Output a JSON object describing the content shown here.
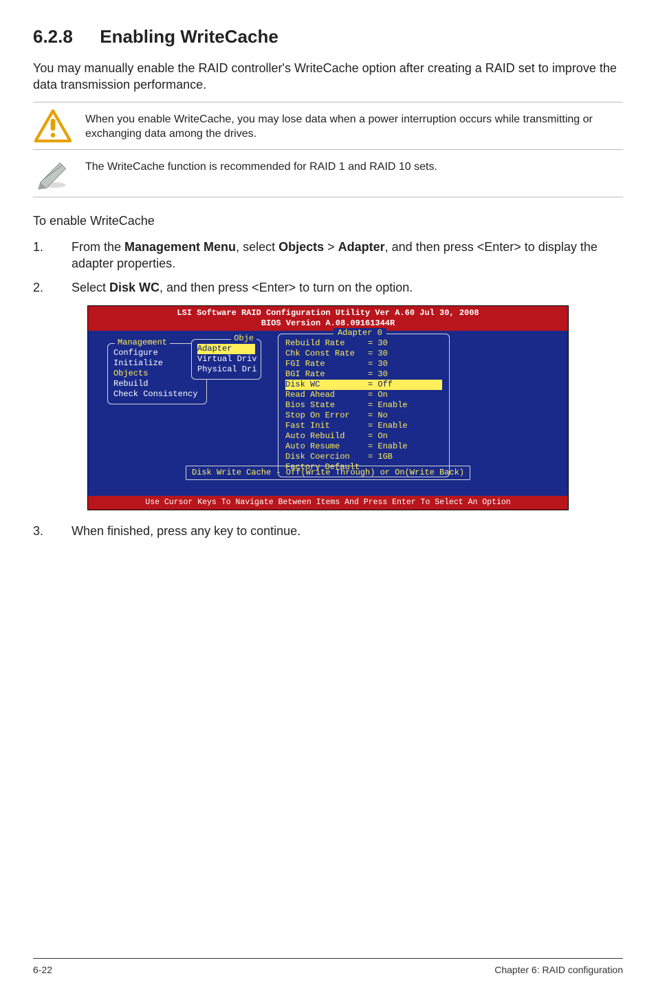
{
  "heading": {
    "number": "6.2.8",
    "title": "Enabling WriteCache"
  },
  "intro": "You may manually enable the RAID controller's WriteCache option after creating a RAID set to improve the data transmission performance.",
  "callouts": {
    "warning": "When you enable WriteCache, you may lose data when a power interruption occurs while transmitting or exchanging data among the drives.",
    "note": "The WriteCache function is recommended for RAID 1 and RAID 10 sets."
  },
  "subhead": "To enable WriteCache",
  "steps": [
    {
      "n": "1.",
      "pre": "From the ",
      "b1": "Management Menu",
      "mid1": ", select ",
      "b2": "Objects",
      "sep": " > ",
      "b3": "Adapter",
      "mid2": ", and then press <Enter> to display the adapter properties."
    },
    {
      "n": "2.",
      "pre": "Select ",
      "b1": "Disk WC",
      "mid1": ", and then press <Enter> to turn on the option."
    }
  ],
  "bios": {
    "title_line1": "LSI Software RAID Configuration Utility Ver A.60 Jul 30, 2008",
    "title_line2": "BIOS Version  A.08.09161344R",
    "mgmt_label": "Management",
    "mgmt_items": [
      "Configure",
      "Initialize",
      "Objects",
      "Rebuild",
      "Check Consistency"
    ],
    "obj_label": "Obje",
    "obj_items": [
      "Adapter",
      "Virtual Driv",
      "Physical Dri"
    ],
    "adapter_title": "Adapter 0",
    "adapter_props": [
      {
        "k": "Rebuild Rate",
        "v": "= 30"
      },
      {
        "k": "Chk Const Rate",
        "v": "= 30"
      },
      {
        "k": "FGI Rate",
        "v": "= 30"
      },
      {
        "k": "BGI Rate",
        "v": "= 30"
      },
      {
        "k": "Disk WC",
        "v": "= Off",
        "sel": true
      },
      {
        "k": "Read Ahead",
        "v": "= On"
      },
      {
        "k": "Bios State",
        "v": "= Enable"
      },
      {
        "k": "Stop On Error",
        "v": "= No"
      },
      {
        "k": "Fast Init",
        "v": "= Enable"
      },
      {
        "k": "Auto Rebuild",
        "v": "= On"
      },
      {
        "k": "Auto Resume",
        "v": "= Enable"
      },
      {
        "k": "Disk Coercion",
        "v": "= 1GB"
      }
    ],
    "factory_default": "Factory Default",
    "hint": "Disk Write Cache - Off(Write Through) or On(Write Back)",
    "footer": "Use Cursor Keys To Navigate Between Items And Press Enter To Select An Option"
  },
  "step3": {
    "n": "3.",
    "text": "When finished, press any key to continue."
  },
  "page_footer": {
    "left": "6-22",
    "right": "Chapter 6: RAID configuration"
  }
}
